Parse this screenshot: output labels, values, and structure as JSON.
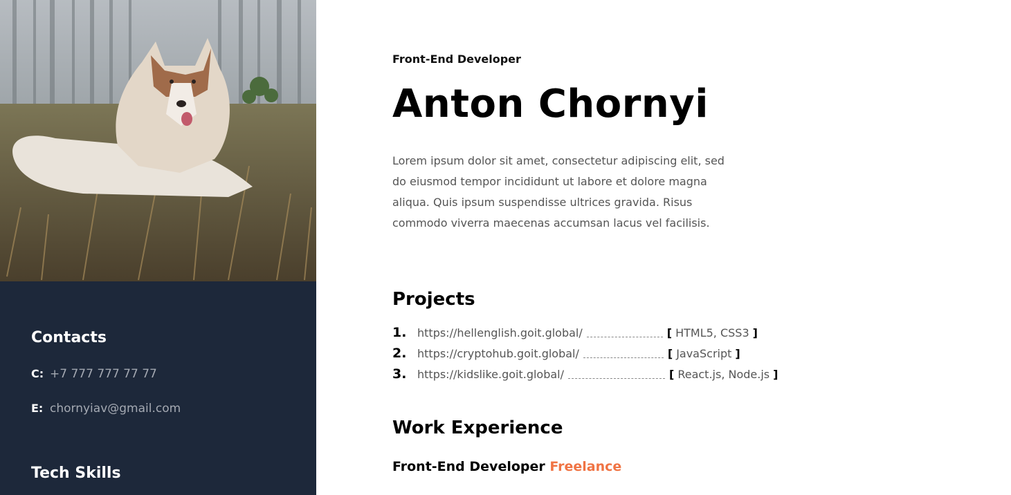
{
  "sidebar": {
    "contacts_title": "Contacts",
    "phone_key": "C:",
    "phone": "+7 777 777 77 77",
    "email_key": "E:",
    "email": "chornyiav@gmail.com",
    "skills_title": "Tech Skills"
  },
  "header": {
    "role": "Front-End Developer",
    "name": "Anton Chornyi",
    "about": "Lorem ipsum dolor sit amet, consectetur adipiscing elit, sed do eiusmod tempor incididunt ut labore et dolore magna aliqua. Quis ipsum suspendisse ultrices gravida. Risus commodo viverra maecenas accumsan lacus vel facilisis."
  },
  "projects": {
    "title": "Projects",
    "items": [
      {
        "num": "1.",
        "url": "https://hellenglish.goit.global/",
        "tech": "HTML5, CSS3"
      },
      {
        "num": "2.",
        "url": "https://cryptohub.goit.global/",
        "tech": "JavaScript"
      },
      {
        "num": "3.",
        "url": "https://kidslike.goit.global/",
        "tech": "React.js, Node.js"
      }
    ]
  },
  "work": {
    "title": "Work Experience",
    "job_title": "Front-End Developer",
    "company": "Freelance"
  },
  "colors": {
    "sidebar_bg": "#1d283a",
    "accent": "#f07444"
  }
}
